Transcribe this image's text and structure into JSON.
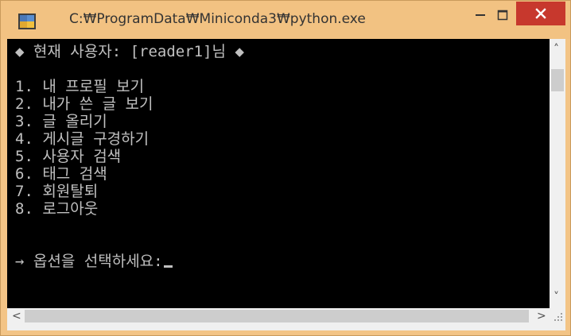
{
  "window": {
    "title": "C:₩ProgramData₩Miniconda3₩python.exe"
  },
  "titlebar_controls": {
    "minimize_icon": "minimize-icon",
    "maximize_icon": "maximize-icon",
    "close_icon": "close-icon"
  },
  "console": {
    "header": "◆ 현재 사용자: [reader1]님 ◆",
    "menu": [
      "1. 내 프로필 보기",
      "2. 내가 쓴 글 보기",
      "3. 글 올리기",
      "4. 게시글 구경하기",
      "5. 사용자 검색",
      "6. 태그 검색",
      "7. 회원탈퇴",
      "8. 로그아웃"
    ],
    "prompt": "→ 옵션을 선택하세요:"
  },
  "scrollbars": {
    "up_arrow": "˄",
    "down_arrow": "˅",
    "left_arrow": "<",
    "right_arrow": ">"
  },
  "colors": {
    "titlebar": "#f2c282",
    "close_button": "#c7382d",
    "console_bg": "#000000",
    "console_text": "#c0c0c0"
  }
}
